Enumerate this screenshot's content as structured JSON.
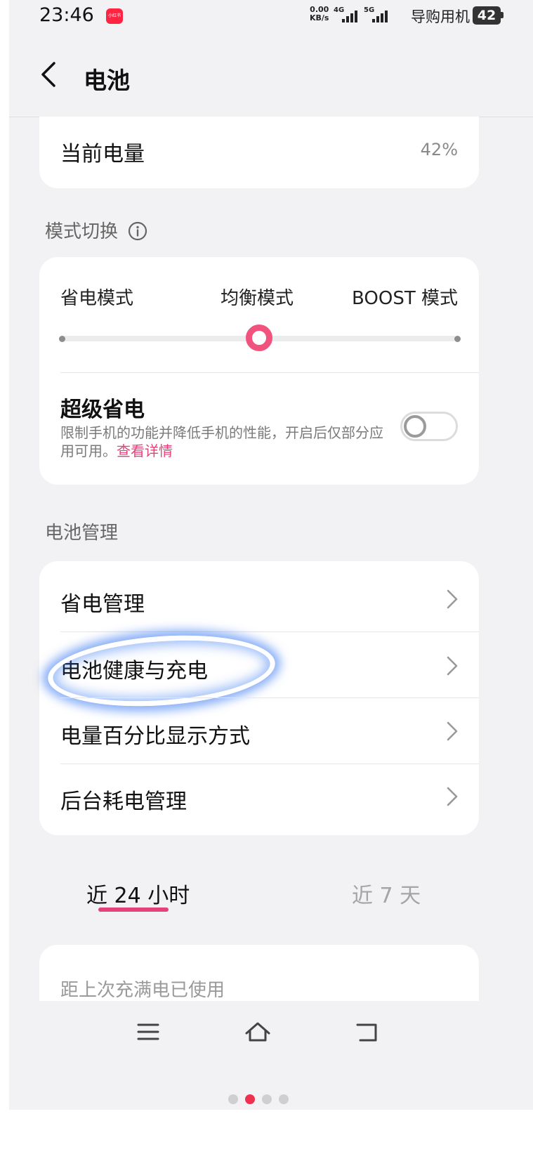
{
  "status_bar": {
    "time": "23:46",
    "app_badge": "小红书",
    "net_speed_value": "0.00",
    "net_speed_unit": "KB/s",
    "sim1_type": "4G",
    "sim2_type": "5G",
    "carrier": "导购用机",
    "battery_level": "42"
  },
  "header": {
    "title": "电池"
  },
  "current_battery": {
    "label": "当前电量",
    "value": "42%"
  },
  "mode_section": {
    "label": "模式切换",
    "modes": [
      "省电模式",
      "均衡模式",
      "BOOST 模式"
    ],
    "selected_index": 1,
    "super_saver": {
      "title": "超级省电",
      "desc": "限制手机的功能并降低手机的性能，开启后仅部分应用可用。",
      "link": "查看详情",
      "enabled": false
    }
  },
  "management": {
    "label": "电池管理",
    "items": [
      {
        "label": "省电管理"
      },
      {
        "label": "电池健康与充电"
      },
      {
        "label": "电量百分比显示方式"
      },
      {
        "label": "后台耗电管理"
      }
    ]
  },
  "tabs": [
    {
      "label": "近 24 小时",
      "active": true
    },
    {
      "label": "近 7 天",
      "active": false
    }
  ],
  "usage_card": {
    "label": "距上次充满电已使用"
  },
  "colors": {
    "accent": "#e6427a",
    "highlight": "#2f6cf0"
  }
}
